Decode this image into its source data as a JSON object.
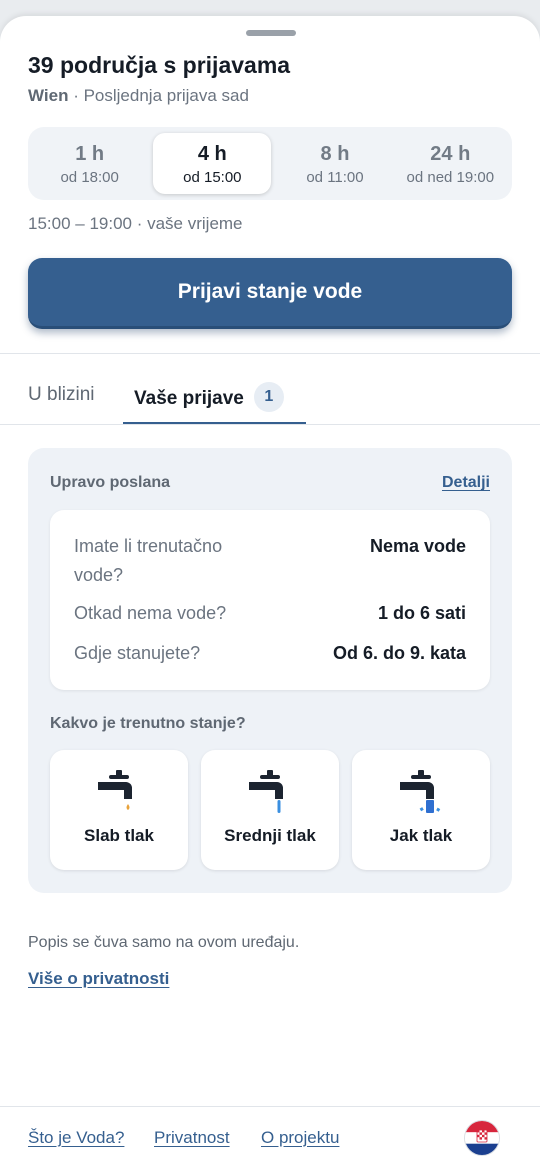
{
  "header": {
    "title": "39 područja s prijavama",
    "city": "Wien",
    "subtitle_rest": " · Posljednja prijava sad"
  },
  "time_ranges": [
    {
      "label": "1 h",
      "sub": "od 18:00",
      "active": false
    },
    {
      "label": "4 h",
      "sub": "od 15:00",
      "active": true
    },
    {
      "label": "8 h",
      "sub": "od 11:00",
      "active": false
    },
    {
      "label": "24 h",
      "sub": "od ned 19:00",
      "active": false
    }
  ],
  "range_text": "15:00 – 19:00 · vaše vrijeme",
  "report_button": "Prijavi stanje vode",
  "tabs": {
    "nearby": "U blizini",
    "mine": "Vaše prijave",
    "mine_count": "1"
  },
  "report_card": {
    "heading": "Upravo poslana",
    "details_link": "Detalji",
    "answers": [
      {
        "q_line1": "Imate li trenutačno",
        "q_line2": "vode?",
        "a": "Nema vode"
      },
      {
        "q_line1": "Otkad nema vode?",
        "a": "1 do 6 sati"
      },
      {
        "q_line1": "Gdje stanujete?",
        "a": "Od 6. do 9. kata"
      }
    ],
    "state_question": "Kakvo je trenutno stanje?",
    "pressure_options": [
      {
        "label": "Slab tlak",
        "icon": "faucet-drip-icon"
      },
      {
        "label": "Srednji tlak",
        "icon": "faucet-stream-icon"
      },
      {
        "label": "Jak tlak",
        "icon": "faucet-strong-stream-icon"
      }
    ]
  },
  "privacy_note": "Popis se čuva samo na ovom uređaju.",
  "privacy_link": "Više o privatnosti",
  "footer": {
    "links": [
      "Što je Voda?",
      "Privatnost",
      "O projektu"
    ],
    "flag_icon": "croatia-flag-icon"
  },
  "colors": {
    "accent": "#355f8f",
    "water": "#3a8fe0",
    "drip": "#e8a23a"
  }
}
